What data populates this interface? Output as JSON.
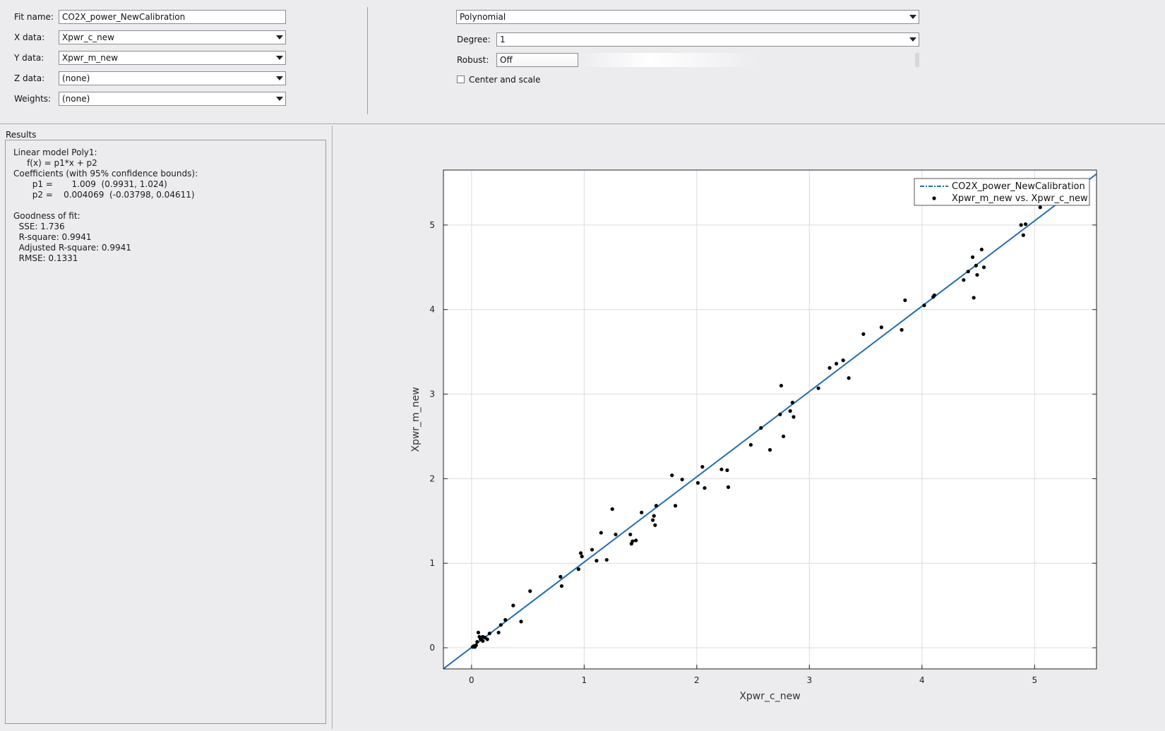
{
  "fit_settings": {
    "fit_name_label": "Fit name:",
    "fit_name_value": "CO2X_power_NewCalibration",
    "x_data_label": "X data:",
    "x_data_value": "Xpwr_c_new",
    "y_data_label": "Y data:",
    "y_data_value": "Xpwr_m_new",
    "z_data_label": "Z data:",
    "z_data_value": "(none)",
    "weights_label": "Weights:",
    "weights_value": "(none)"
  },
  "fit_options": {
    "fit_type": "Polynomial",
    "degree_label": "Degree:",
    "degree_value": "1",
    "robust_label": "Robust:",
    "robust_value": "Off",
    "center_scale_label": "Center and scale",
    "center_scale_checked": false
  },
  "results": {
    "title": "Results",
    "lines": [
      "Linear model Poly1:",
      "     f(x) = p1*x + p2",
      "Coefficients (with 95% confidence bounds):",
      "       p1 =       1.009  (0.9931, 1.024)",
      "       p2 =    0.004069  (-0.03798, 0.04611)",
      "",
      "Goodness of fit:",
      "  SSE: 1.736",
      "  R-square: 0.9941",
      "  Adjusted R-square: 0.9941",
      "  RMSE: 0.1331"
    ]
  },
  "chart_data": {
    "type": "scatter",
    "xlabel": "Xpwr_c_new",
    "ylabel": "Xpwr_m_new",
    "xlim": [
      -0.25,
      5.55
    ],
    "ylim": [
      -0.25,
      5.65
    ],
    "xticks": [
      0,
      1,
      2,
      3,
      4,
      5
    ],
    "yticks": [
      0,
      1,
      2,
      3,
      4,
      5
    ],
    "grid": true,
    "legend_position": "top-right",
    "series": [
      {
        "name": "CO2X_power_NewCalibration",
        "kind": "line",
        "color": "#1f6fb5",
        "p1": 1.009,
        "p2": 0.004069
      },
      {
        "name": "Xpwr_m_new vs. Xpwr_c_new",
        "kind": "scatter",
        "color": "#000000",
        "points": [
          [
            0.01,
            0.01
          ],
          [
            0.02,
            0.02
          ],
          [
            0.03,
            0.01
          ],
          [
            0.04,
            0.03
          ],
          [
            0.05,
            0.07
          ],
          [
            0.06,
            0.18
          ],
          [
            0.07,
            0.13
          ],
          [
            0.08,
            0.1
          ],
          [
            0.1,
            0.13
          ],
          [
            0.1,
            0.08
          ],
          [
            0.12,
            0.12
          ],
          [
            0.14,
            0.1
          ],
          [
            0.16,
            0.17
          ],
          [
            0.24,
            0.18
          ],
          [
            0.26,
            0.27
          ],
          [
            0.3,
            0.33
          ],
          [
            0.37,
            0.5
          ],
          [
            0.44,
            0.31
          ],
          [
            0.52,
            0.67
          ],
          [
            0.79,
            0.84
          ],
          [
            0.8,
            0.73
          ],
          [
            0.95,
            0.93
          ],
          [
            0.97,
            1.12
          ],
          [
            0.98,
            1.08
          ],
          [
            1.07,
            1.16
          ],
          [
            1.11,
            1.03
          ],
          [
            1.15,
            1.36
          ],
          [
            1.2,
            1.04
          ],
          [
            1.25,
            1.64
          ],
          [
            1.28,
            1.34
          ],
          [
            1.41,
            1.34
          ],
          [
            1.42,
            1.23
          ],
          [
            1.43,
            1.26
          ],
          [
            1.46,
            1.27
          ],
          [
            1.51,
            1.6
          ],
          [
            1.61,
            1.51
          ],
          [
            1.62,
            1.56
          ],
          [
            1.63,
            1.45
          ],
          [
            1.64,
            1.68
          ],
          [
            1.78,
            2.04
          ],
          [
            1.81,
            1.68
          ],
          [
            1.87,
            1.99
          ],
          [
            2.01,
            1.95
          ],
          [
            2.05,
            2.14
          ],
          [
            2.07,
            1.89
          ],
          [
            2.22,
            2.11
          ],
          [
            2.27,
            2.1
          ],
          [
            2.28,
            1.9
          ],
          [
            2.48,
            2.4
          ],
          [
            2.57,
            2.6
          ],
          [
            2.65,
            2.34
          ],
          [
            2.74,
            2.76
          ],
          [
            2.75,
            3.1
          ],
          [
            2.77,
            2.5
          ],
          [
            2.83,
            2.8
          ],
          [
            2.85,
            2.9
          ],
          [
            2.86,
            2.73
          ],
          [
            3.08,
            3.07
          ],
          [
            3.18,
            3.31
          ],
          [
            3.24,
            3.36
          ],
          [
            3.3,
            3.4
          ],
          [
            3.35,
            3.19
          ],
          [
            3.48,
            3.71
          ],
          [
            3.64,
            3.79
          ],
          [
            3.82,
            3.76
          ],
          [
            3.85,
            4.11
          ],
          [
            4.02,
            4.05
          ],
          [
            4.1,
            4.15
          ],
          [
            4.11,
            4.17
          ],
          [
            4.37,
            4.35
          ],
          [
            4.41,
            4.45
          ],
          [
            4.45,
            4.62
          ],
          [
            4.46,
            4.14
          ],
          [
            4.48,
            4.52
          ],
          [
            4.49,
            4.41
          ],
          [
            4.53,
            4.71
          ],
          [
            4.55,
            4.5
          ],
          [
            4.88,
            5
          ],
          [
            4.9,
            4.88
          ],
          [
            4.92,
            5.01
          ],
          [
            5.05,
            5.21
          ]
        ]
      }
    ]
  }
}
